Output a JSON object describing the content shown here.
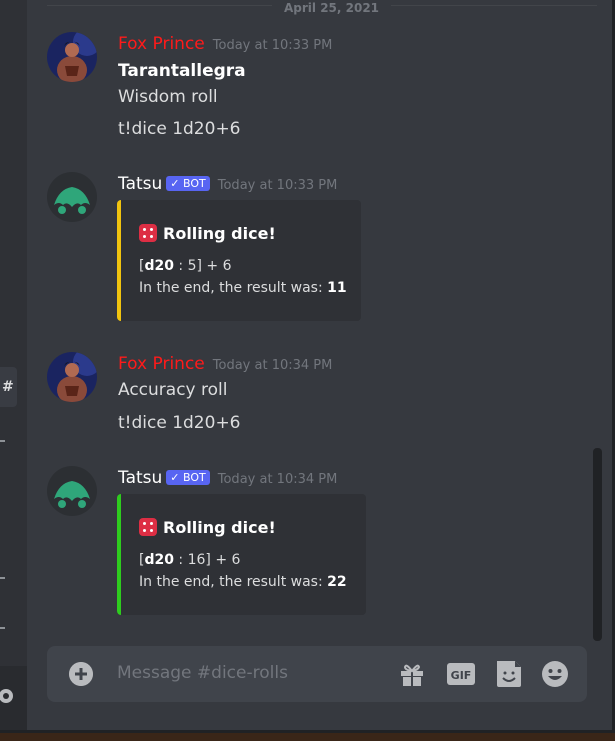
{
  "date_divider": "April 25, 2021",
  "messages": [
    {
      "author": "Fox Prince",
      "timestamp": "Today at 10:33 PM",
      "lines": [
        "Tarantallegra",
        "Wisdom roll",
        "t!dice 1d20+6"
      ]
    },
    {
      "author": "Tatsu",
      "bot_tag": "✓ BOT",
      "timestamp": "Today at 10:33 PM",
      "embed": {
        "title": "Rolling dice!",
        "roll_open": "[",
        "roll_die": "d20",
        "roll_rest": " : 5] + 6",
        "result_prefix": "In the end, the result was: ",
        "result_value": "11",
        "accent": "#f1c40f"
      }
    },
    {
      "author": "Fox Prince",
      "timestamp": "Today at 10:34 PM",
      "lines": [
        "Accuracy roll",
        "t!dice 1d20+6"
      ]
    },
    {
      "author": "Tatsu",
      "bot_tag": "✓ BOT",
      "timestamp": "Today at 10:34 PM",
      "embed": {
        "title": "Rolling dice!",
        "roll_open": "[",
        "roll_die": "d20",
        "roll_rest": " : 16] + 6",
        "result_prefix": "In the end, the result was: ",
        "result_value": "22",
        "accent": "#2ecc1e"
      }
    }
  ],
  "composer": {
    "placeholder": "Message #dice-rolls",
    "gif_label": "GIF"
  },
  "left_strip": {
    "tab_glyph": "#"
  },
  "icons": [
    "add-icon",
    "gift-icon",
    "gif-icon",
    "sticker-icon",
    "emoji-icon",
    "gear-icon",
    "dice-icon"
  ]
}
